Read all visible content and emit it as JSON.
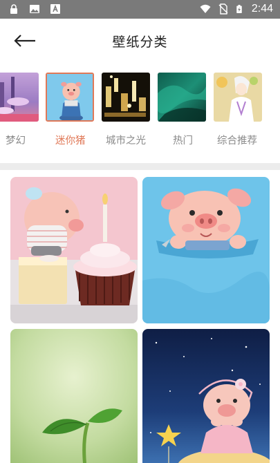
{
  "status_bar": {
    "time": "2:44",
    "icons": [
      "lock-icon",
      "image-icon",
      "text-a-icon",
      "wifi-icon",
      "no-sim-icon",
      "battery-charging-icon"
    ]
  },
  "header": {
    "title": "壁纸分类",
    "back_icon": "arrow-left-icon"
  },
  "categories": [
    {
      "label": "梦幻",
      "active": false
    },
    {
      "label": "迷你猪",
      "active": true
    },
    {
      "label": "城市之光",
      "active": false
    },
    {
      "label": "热门",
      "active": false
    },
    {
      "label": "综合推荐",
      "active": false
    }
  ],
  "colors": {
    "accent": "#e07857",
    "status_bar": "#7a7a7a",
    "divider": "#ececec"
  },
  "wallpapers": [
    {
      "subject": "pig-cupcake"
    },
    {
      "subject": "pig-pocket"
    },
    {
      "subject": "sprout"
    },
    {
      "subject": "pig-night-star"
    }
  ]
}
